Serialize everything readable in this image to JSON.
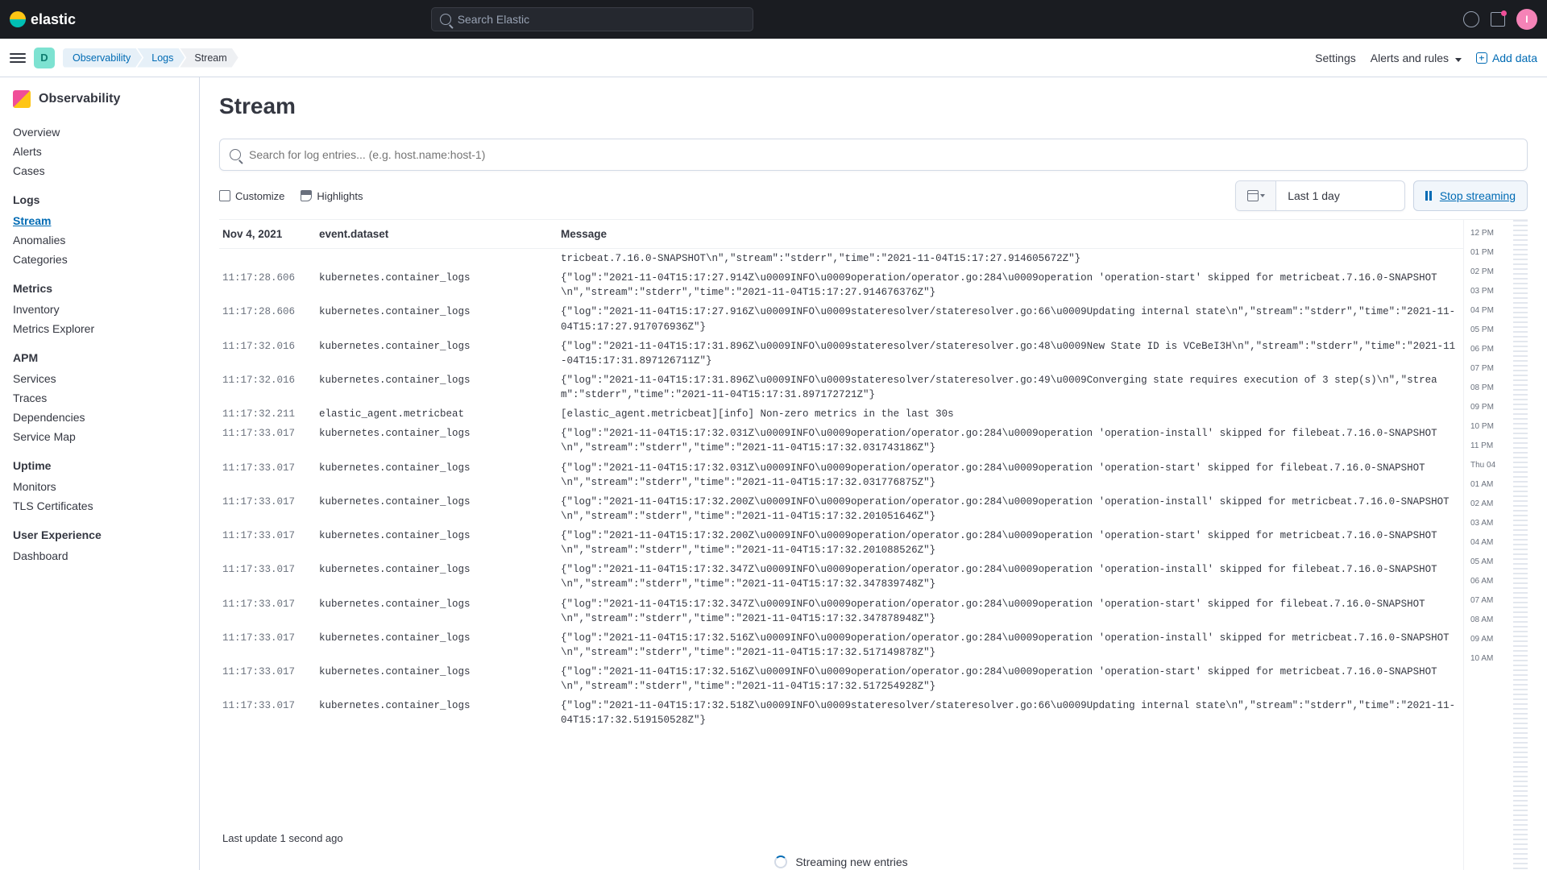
{
  "header": {
    "brand": "elastic",
    "search_placeholder": "Search Elastic",
    "avatar_initial": "I",
    "space_initial": "D"
  },
  "breadcrumbs": [
    "Observability",
    "Logs",
    "Stream"
  ],
  "subheader": {
    "settings": "Settings",
    "alerts": "Alerts and rules",
    "add_data": "Add data"
  },
  "sidebar": {
    "title": "Observability",
    "groups": [
      {
        "head": null,
        "items": [
          "Overview",
          "Alerts",
          "Cases"
        ]
      },
      {
        "head": "Logs",
        "items": [
          "Stream",
          "Anomalies",
          "Categories"
        ],
        "active": "Stream"
      },
      {
        "head": "Metrics",
        "items": [
          "Inventory",
          "Metrics Explorer"
        ]
      },
      {
        "head": "APM",
        "items": [
          "Services",
          "Traces",
          "Dependencies",
          "Service Map"
        ]
      },
      {
        "head": "Uptime",
        "items": [
          "Monitors",
          "TLS Certificates"
        ]
      },
      {
        "head": "User Experience",
        "items": [
          "Dashboard"
        ]
      }
    ]
  },
  "page": {
    "title": "Stream",
    "search_placeholder": "Search for log entries... (e.g. host.name:host-1)",
    "customize": "Customize",
    "highlights": "Highlights",
    "date_label": "Last 1 day",
    "stream_btn": "Stop streaming",
    "last_update": "Last update 1 second ago",
    "streaming_msg": "Streaming new entries"
  },
  "columns": {
    "date": "Nov 4, 2021",
    "dataset": "event.dataset",
    "message": "Message"
  },
  "logs": [
    {
      "t": "",
      "ds": "",
      "m": "tricbeat.7.16.0-SNAPSHOT\\n\",\"stream\":\"stderr\",\"time\":\"2021-11-04T15:17:27.914605672Z\"}"
    },
    {
      "t": "11:17:28.606",
      "ds": "kubernetes.container_logs",
      "m": "{\"log\":\"2021-11-04T15:17:27.914Z\\u0009INFO\\u0009operation/operator.go:284\\u0009operation 'operation-start' skipped for metricbeat.7.16.0-SNAPSHOT\\n\",\"stream\":\"stderr\",\"time\":\"2021-11-04T15:17:27.914676376Z\"}"
    },
    {
      "t": "11:17:28.606",
      "ds": "kubernetes.container_logs",
      "m": "{\"log\":\"2021-11-04T15:17:27.916Z\\u0009INFO\\u0009stateresolver/stateresolver.go:66\\u0009Updating internal state\\n\",\"stream\":\"stderr\",\"time\":\"2021-11-04T15:17:27.917076936Z\"}"
    },
    {
      "t": "11:17:32.016",
      "ds": "kubernetes.container_logs",
      "m": "{\"log\":\"2021-11-04T15:17:31.896Z\\u0009INFO\\u0009stateresolver/stateresolver.go:48\\u0009New State ID is VCeBeI3H\\n\",\"stream\":\"stderr\",\"time\":\"2021-11-04T15:17:31.897126711Z\"}"
    },
    {
      "t": "11:17:32.016",
      "ds": "kubernetes.container_logs",
      "m": "{\"log\":\"2021-11-04T15:17:31.896Z\\u0009INFO\\u0009stateresolver/stateresolver.go:49\\u0009Converging state requires execution of 3 step(s)\\n\",\"stream\":\"stderr\",\"time\":\"2021-11-04T15:17:31.897172721Z\"}"
    },
    {
      "t": "11:17:32.211",
      "ds": "elastic_agent.metricbeat",
      "m": "[elastic_agent.metricbeat][info] Non-zero metrics in the last 30s"
    },
    {
      "t": "11:17:33.017",
      "ds": "kubernetes.container_logs",
      "m": "{\"log\":\"2021-11-04T15:17:32.031Z\\u0009INFO\\u0009operation/operator.go:284\\u0009operation 'operation-install' skipped for filebeat.7.16.0-SNAPSHOT\\n\",\"stream\":\"stderr\",\"time\":\"2021-11-04T15:17:32.031743186Z\"}"
    },
    {
      "t": "11:17:33.017",
      "ds": "kubernetes.container_logs",
      "m": "{\"log\":\"2021-11-04T15:17:32.031Z\\u0009INFO\\u0009operation/operator.go:284\\u0009operation 'operation-start' skipped for filebeat.7.16.0-SNAPSHOT\\n\",\"stream\":\"stderr\",\"time\":\"2021-11-04T15:17:32.031776875Z\"}"
    },
    {
      "t": "11:17:33.017",
      "ds": "kubernetes.container_logs",
      "m": "{\"log\":\"2021-11-04T15:17:32.200Z\\u0009INFO\\u0009operation/operator.go:284\\u0009operation 'operation-install' skipped for metricbeat.7.16.0-SNAPSHOT\\n\",\"stream\":\"stderr\",\"time\":\"2021-11-04T15:17:32.201051646Z\"}"
    },
    {
      "t": "11:17:33.017",
      "ds": "kubernetes.container_logs",
      "m": "{\"log\":\"2021-11-04T15:17:32.200Z\\u0009INFO\\u0009operation/operator.go:284\\u0009operation 'operation-start' skipped for metricbeat.7.16.0-SNAPSHOT\\n\",\"stream\":\"stderr\",\"time\":\"2021-11-04T15:17:32.201088526Z\"}"
    },
    {
      "t": "11:17:33.017",
      "ds": "kubernetes.container_logs",
      "m": "{\"log\":\"2021-11-04T15:17:32.347Z\\u0009INFO\\u0009operation/operator.go:284\\u0009operation 'operation-install' skipped for filebeat.7.16.0-SNAPSHOT\\n\",\"stream\":\"stderr\",\"time\":\"2021-11-04T15:17:32.347839748Z\"}"
    },
    {
      "t": "11:17:33.017",
      "ds": "kubernetes.container_logs",
      "m": "{\"log\":\"2021-11-04T15:17:32.347Z\\u0009INFO\\u0009operation/operator.go:284\\u0009operation 'operation-start' skipped for filebeat.7.16.0-SNAPSHOT\\n\",\"stream\":\"stderr\",\"time\":\"2021-11-04T15:17:32.347878948Z\"}"
    },
    {
      "t": "11:17:33.017",
      "ds": "kubernetes.container_logs",
      "m": "{\"log\":\"2021-11-04T15:17:32.516Z\\u0009INFO\\u0009operation/operator.go:284\\u0009operation 'operation-install' skipped for metricbeat.7.16.0-SNAPSHOT\\n\",\"stream\":\"stderr\",\"time\":\"2021-11-04T15:17:32.517149878Z\"}"
    },
    {
      "t": "11:17:33.017",
      "ds": "kubernetes.container_logs",
      "m": "{\"log\":\"2021-11-04T15:17:32.516Z\\u0009INFO\\u0009operation/operator.go:284\\u0009operation 'operation-start' skipped for metricbeat.7.16.0-SNAPSHOT\\n\",\"stream\":\"stderr\",\"time\":\"2021-11-04T15:17:32.517254928Z\"}"
    },
    {
      "t": "11:17:33.017",
      "ds": "kubernetes.container_logs",
      "m": "{\"log\":\"2021-11-04T15:17:32.518Z\\u0009INFO\\u0009stateresolver/stateresolver.go:66\\u0009Updating internal state\\n\",\"stream\":\"stderr\",\"time\":\"2021-11-04T15:17:32.519150528Z\"}"
    }
  ],
  "minimap": [
    "12 PM",
    "01 PM",
    "02 PM",
    "03 PM",
    "04 PM",
    "05 PM",
    "06 PM",
    "07 PM",
    "08 PM",
    "09 PM",
    "10 PM",
    "11 PM",
    "Thu 04",
    "01 AM",
    "02 AM",
    "03 AM",
    "04 AM",
    "05 AM",
    "06 AM",
    "07 AM",
    "08 AM",
    "09 AM",
    "10 AM"
  ]
}
